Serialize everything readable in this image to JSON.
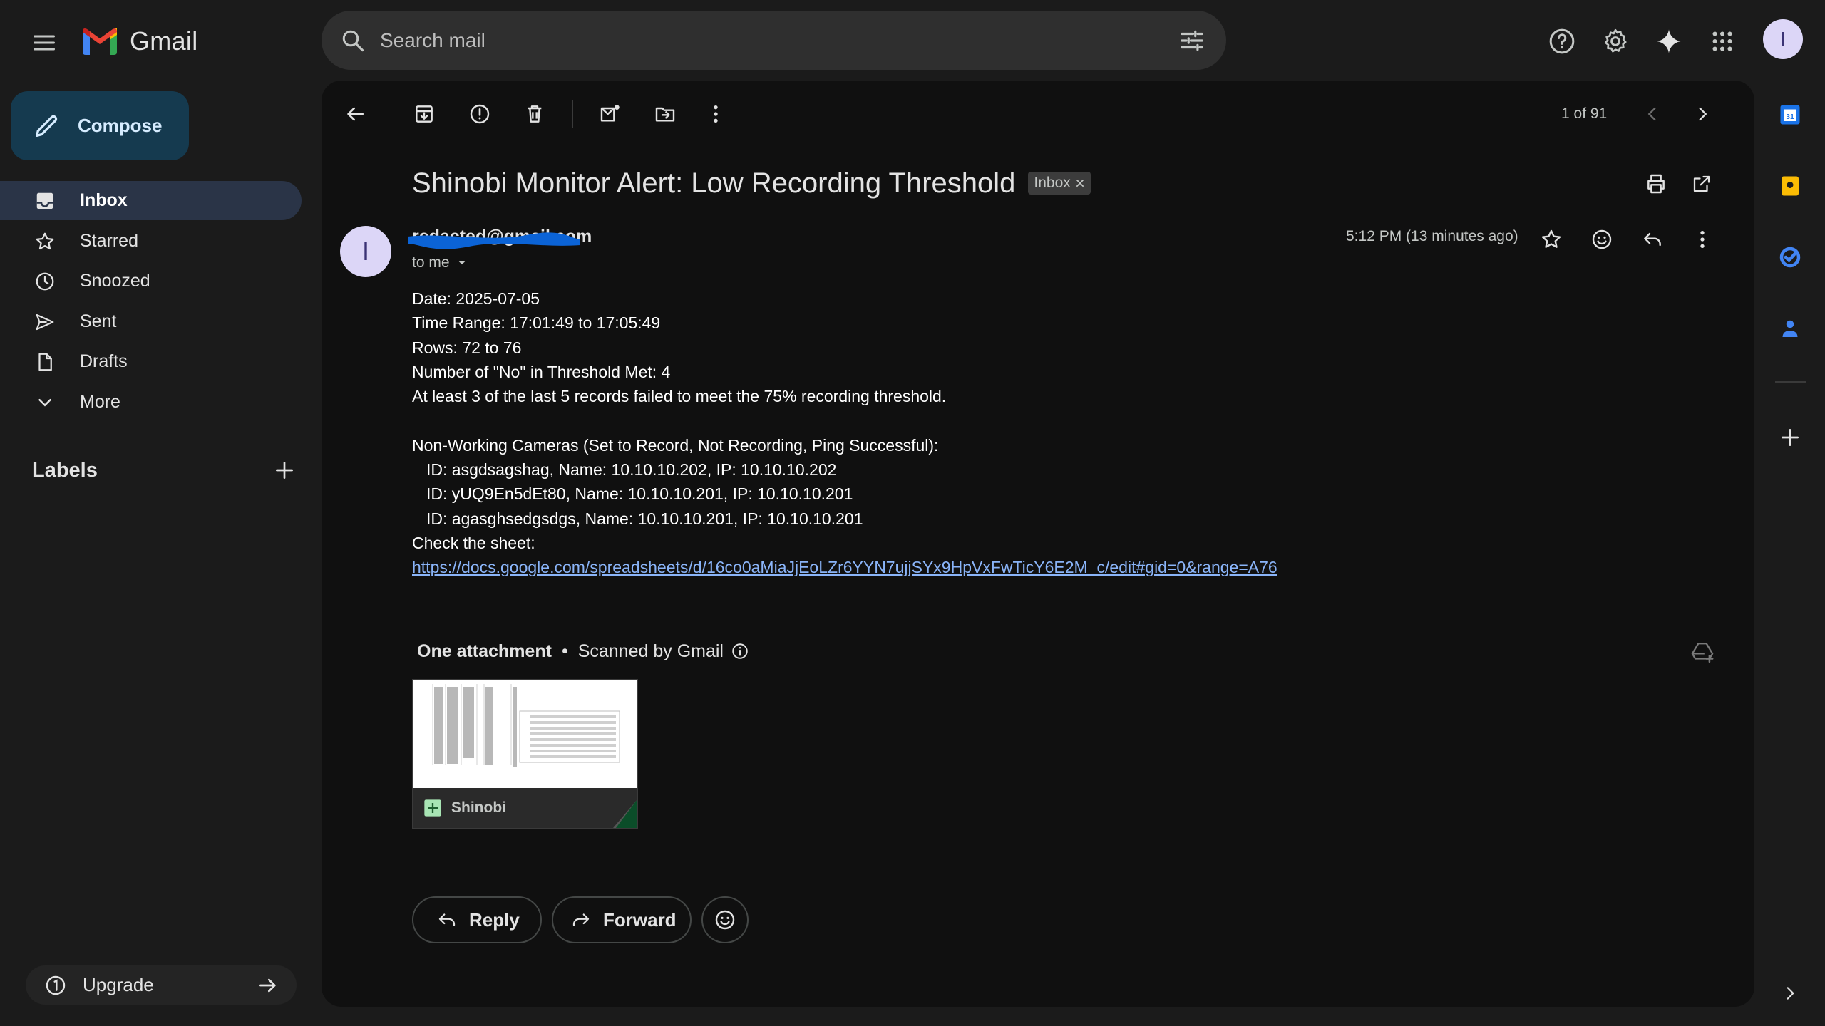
{
  "app": {
    "name": "Gmail"
  },
  "search": {
    "placeholder": "Search mail"
  },
  "compose": {
    "label": "Compose"
  },
  "nav": {
    "items": [
      {
        "label": "Inbox",
        "icon": "inbox-icon",
        "active": true
      },
      {
        "label": "Starred",
        "icon": "star-icon"
      },
      {
        "label": "Snoozed",
        "icon": "clock-icon"
      },
      {
        "label": "Sent",
        "icon": "send-icon"
      },
      {
        "label": "Drafts",
        "icon": "draft-icon"
      },
      {
        "label": "More",
        "icon": "chevron-down-icon"
      }
    ],
    "labels_heading": "Labels",
    "upgrade_label": "Upgrade"
  },
  "account": {
    "initial": "I"
  },
  "toolbar": {
    "pager": "1 of 91"
  },
  "message": {
    "subject": "Shinobi Monitor Alert: Low Recording Threshold",
    "badge": "Inbox",
    "sender_initial": "I",
    "sender_email": "redacted@gmail.com",
    "to": "to me",
    "time": "5:12 PM (13 minutes ago)",
    "body_lines": {
      "l1": "Date: 2025-07-05",
      "l2": "Time Range: 17:01:49 to 17:05:49",
      "l3": "Rows: 72 to 76",
      "l4": "Number of \"No\" in Threshold Met: 4",
      "l5": "At least 3 of the last 5 records failed to meet the 75% recording threshold.",
      "l6": "Non-Working Cameras (Set to Record, Not Recording, Ping Successful):",
      "l7": "ID: asgdsagshag, Name: 10.10.10.202, IP: 10.10.10.202",
      "l8": "ID: yUQ9En5dEt80, Name: 10.10.10.201, IP: 10.10.10.201",
      "l9": "ID: agasghsedgsdgs, Name: 10.10.10.201, IP: 10.10.10.201",
      "l10": "Check the sheet:",
      "link": "https://docs.google.com/spreadsheets/d/16co0aMiaJjEoLZr6YYN7ujjSYx9HpVxFwTicY6E2M_c/edit#gid=0&range=A76"
    }
  },
  "attachments": {
    "heading": "One attachment",
    "scanned": "Scanned by Gmail",
    "file_name": "Shinobi"
  },
  "actions": {
    "reply": "Reply",
    "forward": "Forward"
  },
  "colors": {
    "accent": "#8ab4f8",
    "compose_bg": "#153a4f",
    "active_nav": "#2a3447",
    "redaction": "#0b63d6"
  }
}
